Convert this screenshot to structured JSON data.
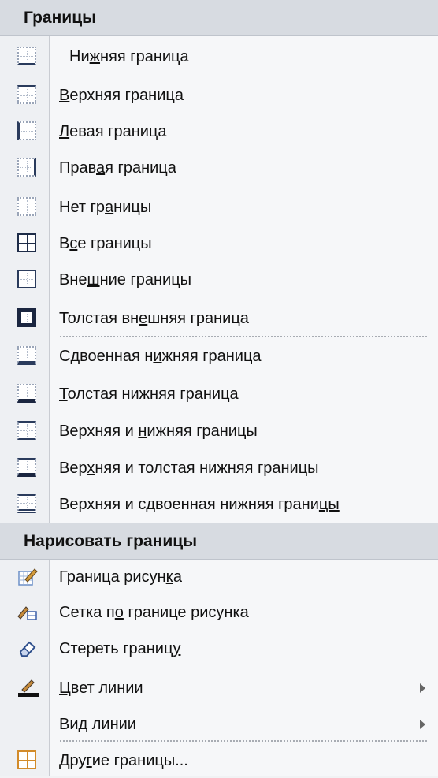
{
  "sections": {
    "borders_header": "Границы",
    "draw_header": "Нарисовать границы"
  },
  "border_items": [
    {
      "pre": "Ни",
      "u": "ж",
      "post": "няя граница",
      "icon": "bottom-border-icon"
    },
    {
      "pre": "",
      "u": "В",
      "post": "ерхняя граница",
      "icon": "top-border-icon"
    },
    {
      "pre": "",
      "u": "Л",
      "post": "евая граница",
      "icon": "left-border-icon"
    },
    {
      "pre": "Прав",
      "u": "а",
      "post": "я граница",
      "icon": "right-border-icon"
    },
    {
      "pre": "Нет гр",
      "u": "а",
      "post": "ницы",
      "icon": "no-border-icon"
    },
    {
      "pre": "В",
      "u": "с",
      "post": "е границы",
      "icon": "all-borders-icon"
    },
    {
      "pre": "Вне",
      "u": "ш",
      "post": "ние границы",
      "icon": "outside-borders-icon"
    },
    {
      "pre": "Толстая вн",
      "u": "е",
      "post": "шняя граница",
      "icon": "thick-box-border-icon"
    },
    {
      "pre": "Сдвоенная н",
      "u": "и",
      "post": "жняя граница",
      "icon": "double-bottom-border-icon"
    },
    {
      "pre": "",
      "u": "Т",
      "post": "олстая нижняя граница",
      "icon": "thick-bottom-border-icon"
    },
    {
      "pre": "Верхняя и ",
      "u": "н",
      "post": "ижняя границы",
      "icon": "top-bottom-border-icon"
    },
    {
      "pre": "Вер",
      "u": "х",
      "post": "няя и толстая нижняя границы",
      "icon": "top-thick-bottom-border-icon"
    },
    {
      "pre": "Верхняя и сдвоенная нижняя грани",
      "u": "цы",
      "post": "",
      "icon": "top-double-bottom-border-icon"
    }
  ],
  "draw_items": [
    {
      "pre": "Граница рисун",
      "u": "к",
      "post": "а",
      "icon": "draw-border-icon"
    },
    {
      "pre": "Сетка п",
      "u": "о",
      "post": " границе рисунка",
      "icon": "draw-border-grid-icon"
    },
    {
      "pre": "Стереть границ",
      "u": "у",
      "post": "",
      "icon": "eraser-icon"
    },
    {
      "pre": "",
      "u": "Ц",
      "post": "вет линии",
      "icon": "line-color-icon"
    },
    {
      "pre": "Ви",
      "u": "д",
      "post": " линии",
      "icon": ""
    },
    {
      "pre": "Дру",
      "u": "г",
      "post": "ие границы...",
      "icon": "more-borders-icon"
    }
  ]
}
